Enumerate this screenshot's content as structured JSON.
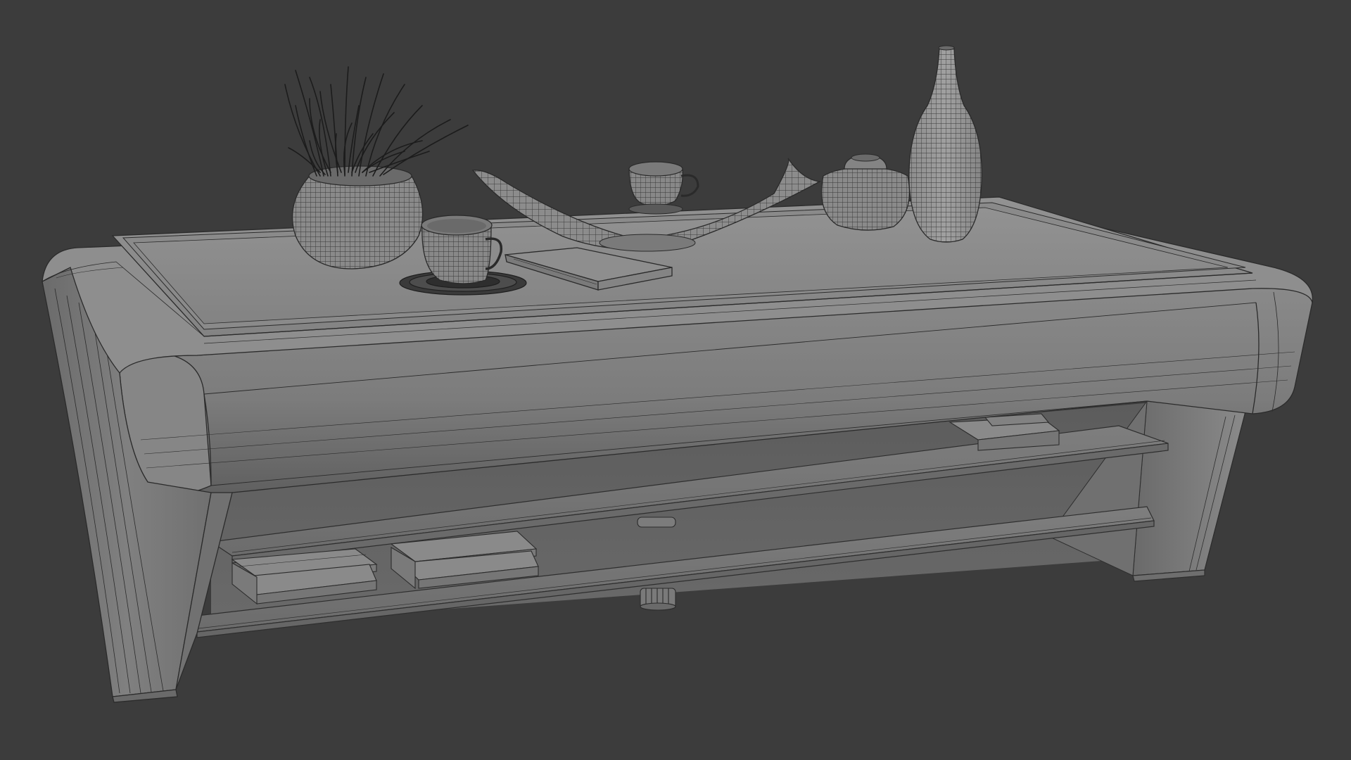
{
  "scene": {
    "subject": "coffee-table-wireframe-render",
    "colors": {
      "background": "#3c3c3c",
      "surface_light": "#8c8c8c",
      "surface_mid": "#7a7a7a",
      "surface_dark": "#5e5e5e",
      "shadow": "#4a4a4a",
      "wire": "#2a2a2a",
      "plant": "#1e1e1e"
    },
    "objects": [
      "coffee-table",
      "shelf-upper",
      "shelf-lower",
      "plant-pot",
      "plant-grass",
      "teacup-front",
      "saucer-front",
      "teacup-back",
      "decorative-tray",
      "book-top",
      "round-jar",
      "tall-vase",
      "books-upper-shelf",
      "books-lower-shelf-left",
      "books-lower-shelf-middle",
      "center-support-leg"
    ]
  }
}
